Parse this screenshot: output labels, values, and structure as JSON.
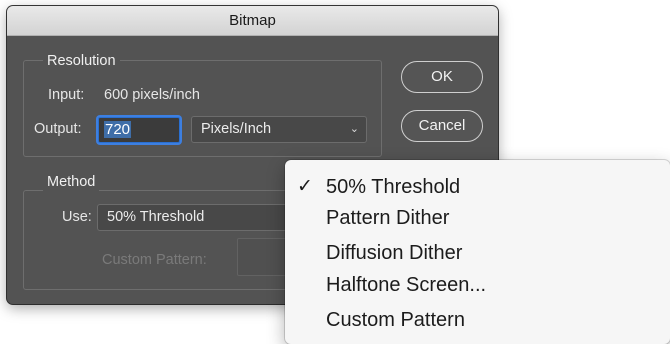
{
  "dialog": {
    "title": "Bitmap",
    "resolution": {
      "group_title": "Resolution",
      "input_label": "Input:",
      "input_value": "600 pixels/inch",
      "output_label": "Output:",
      "output_value": "720",
      "unit_select": "Pixels/Inch"
    },
    "method": {
      "group_title": "Method",
      "use_label": "Use:",
      "use_value": "50% Threshold",
      "custom_pattern_label": "Custom Pattern:"
    },
    "buttons": {
      "ok": "OK",
      "cancel": "Cancel"
    }
  },
  "menu": {
    "items": [
      {
        "label": "50% Threshold",
        "check": "✓"
      },
      {
        "label": "Pattern Dither",
        "check": ""
      },
      {
        "label": "Diffusion Dither",
        "check": ""
      },
      {
        "label": "Halftone Screen...",
        "check": ""
      },
      {
        "label": "Custom Pattern",
        "check": ""
      }
    ]
  },
  "colors": {
    "dialog_bg": "#535353",
    "focus_ring": "#3d7fe0",
    "menu_bg": "#f6f6f6"
  },
  "icons": {
    "dropdown": "chevron-down-icon",
    "checked": "checkmark-icon"
  }
}
